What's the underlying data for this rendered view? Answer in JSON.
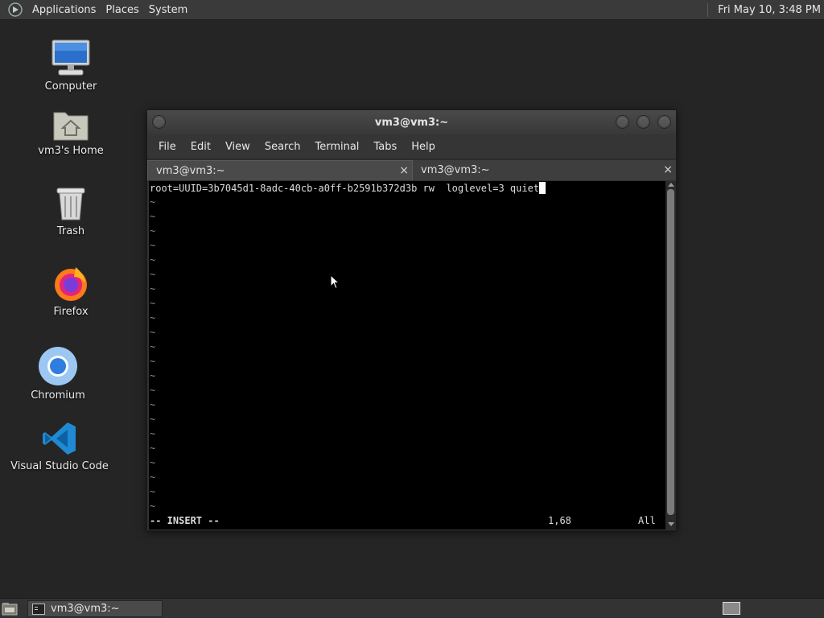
{
  "top_panel": {
    "menus": [
      "Applications",
      "Places",
      "System"
    ],
    "clock": "Fri May 10,  3:48 PM"
  },
  "desktop_icons": [
    {
      "label": "Computer",
      "icon": "computer-icon"
    },
    {
      "label": "vm3's Home",
      "icon": "home-folder-icon"
    },
    {
      "label": "Trash",
      "icon": "trash-icon"
    },
    {
      "label": "Firefox",
      "icon": "firefox-icon"
    },
    {
      "label": "Chromium",
      "icon": "chromium-icon"
    },
    {
      "label": "Visual Studio Code",
      "icon": "vscode-icon"
    }
  ],
  "window": {
    "title": "vm3@vm3:~",
    "menus": [
      "File",
      "Edit",
      "View",
      "Search",
      "Terminal",
      "Tabs",
      "Help"
    ],
    "tabs": [
      {
        "label": "vm3@vm3:~",
        "active": true
      },
      {
        "label": "vm3@vm3:~",
        "active": false
      }
    ],
    "close_glyph": "×"
  },
  "terminal": {
    "first_line": "root=UUID=3b7045d1-8adc-40cb-a0ff-b2591b372d3b rw  loglevel=3 quiet",
    "empty_line_marker": "~",
    "empty_line_count": 22,
    "status_mode": "-- INSERT --",
    "status_position": "1,68",
    "status_scroll": "All"
  },
  "taskbar": {
    "task_label": "vm3@vm3:~"
  },
  "colors": {
    "desktop_bg": "#252525",
    "panel_bg": "#3a3a3a",
    "terminal_bg": "#000000",
    "terminal_fg": "#dcdcdc"
  }
}
